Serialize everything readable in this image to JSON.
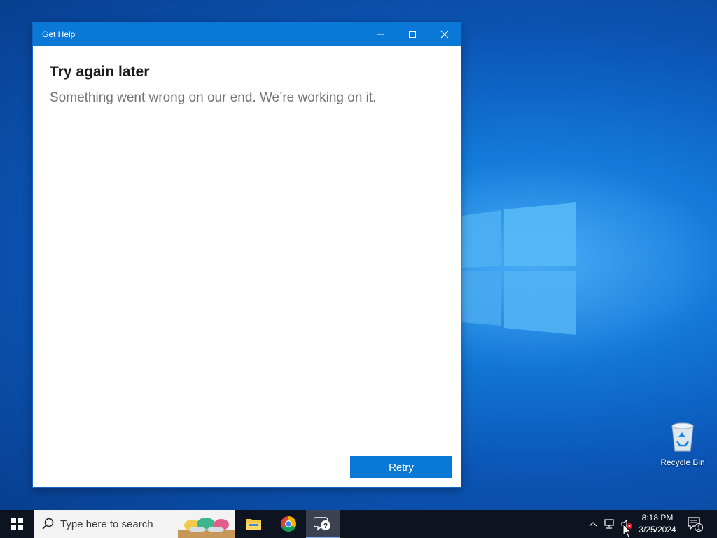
{
  "window": {
    "title": "Get Help",
    "heading": "Try again later",
    "message": "Something went wrong on our end. We’re working on it.",
    "retry_label": "Retry"
  },
  "desktop": {
    "icons": [
      {
        "label": "Recycle Bin",
        "icon": "recycle-bin-icon"
      }
    ]
  },
  "taskbar": {
    "search_placeholder": "Type here to search",
    "apps": [
      "file-explorer",
      "chrome",
      "get-help"
    ],
    "active_app": "get-help",
    "clock_time": "8:18 PM",
    "clock_date": "3/25/2024",
    "notification_count": "1"
  },
  "colors": {
    "accent": "#0a78d7",
    "taskbar": "#0e1320",
    "desktop": "#1379d8"
  }
}
